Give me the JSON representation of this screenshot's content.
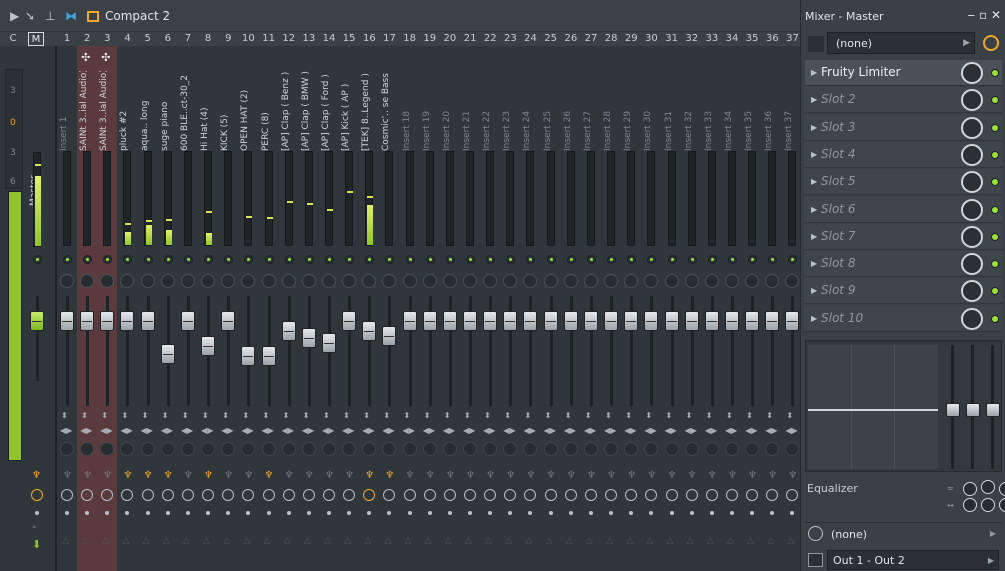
{
  "toolbar": {
    "title": "Compact 2"
  },
  "header": {
    "c_label": "C",
    "m_label": "M",
    "numbers": [
      "1",
      "2",
      "3",
      "4",
      "5",
      "6",
      "7",
      "8",
      "9",
      "10",
      "11",
      "12",
      "13",
      "14",
      "15",
      "16",
      "17",
      "18",
      "19",
      "20",
      "21",
      "22",
      "23",
      "24",
      "25",
      "26",
      "27",
      "28",
      "29",
      "30",
      "31",
      "32",
      "33",
      "34",
      "35",
      "36",
      "37"
    ]
  },
  "left": {
    "scale": [
      "3",
      "0",
      "3",
      "6"
    ],
    "master_name": "Master"
  },
  "strips": [
    {
      "name": "Insert 1",
      "dim": true,
      "red": false
    },
    {
      "name": "SAINt 3..ial Audio)",
      "dim": false,
      "red": true
    },
    {
      "name": "SAINt 3..ial Audio)",
      "dim": false,
      "red": true
    },
    {
      "name": "pluck #2",
      "dim": false,
      "red": false
    },
    {
      "name": "aqua.. long",
      "dim": false,
      "red": false
    },
    {
      "name": "suge piano",
      "dim": false,
      "red": false
    },
    {
      "name": "600 BLE..ct-30_2",
      "dim": false,
      "red": false
    },
    {
      "name": "Hi Hat (4)",
      "dim": false,
      "red": false
    },
    {
      "name": "KICK (5)",
      "dim": false,
      "red": false
    },
    {
      "name": "OPEN HAT (2)",
      "dim": false,
      "red": false
    },
    {
      "name": "PERC (8)",
      "dim": false,
      "red": false
    },
    {
      "name": "[AP] Clap ( Benz )",
      "dim": false,
      "red": false
    },
    {
      "name": "[AP] Clap ( BMW )",
      "dim": false,
      "red": false
    },
    {
      "name": "[AP] Clap ( Ford )",
      "dim": false,
      "red": false
    },
    {
      "name": "[AP] Kick ( AP )",
      "dim": false,
      "red": false
    },
    {
      "name": "[TEK] 8..Legend )",
      "dim": false,
      "red": false
    },
    {
      "name": "Cosmic'.. se Bass 1",
      "dim": false,
      "red": false
    },
    {
      "name": "Insert 18",
      "dim": true,
      "red": false
    },
    {
      "name": "Insert 19",
      "dim": true,
      "red": false
    },
    {
      "name": "Insert 20",
      "dim": true,
      "red": false
    },
    {
      "name": "Insert 21",
      "dim": true,
      "red": false
    },
    {
      "name": "Insert 22",
      "dim": true,
      "red": false
    },
    {
      "name": "Insert 23",
      "dim": true,
      "red": false
    },
    {
      "name": "Insert 24",
      "dim": true,
      "red": false
    },
    {
      "name": "Insert 25",
      "dim": true,
      "red": false
    },
    {
      "name": "Insert 26",
      "dim": true,
      "red": false
    },
    {
      "name": "Insert 27",
      "dim": true,
      "red": false
    },
    {
      "name": "Insert 28",
      "dim": true,
      "red": false
    },
    {
      "name": "Insert 29",
      "dim": true,
      "red": false
    },
    {
      "name": "Insert 30",
      "dim": true,
      "red": false
    },
    {
      "name": "Insert 31",
      "dim": true,
      "red": false
    },
    {
      "name": "Insert 32",
      "dim": true,
      "red": false
    },
    {
      "name": "Insert 33",
      "dim": true,
      "red": false
    },
    {
      "name": "Insert 34",
      "dim": true,
      "red": false
    },
    {
      "name": "Insert 35",
      "dim": true,
      "red": false
    },
    {
      "name": "Insert 36",
      "dim": true,
      "red": false
    },
    {
      "name": "Insert 37",
      "dim": true,
      "red": false
    }
  ],
  "panel": {
    "title": "Mixer - Master",
    "input": "(none)",
    "slots": [
      "Fruity Limiter",
      "Slot 2",
      "Slot 3",
      "Slot 4",
      "Slot 5",
      "Slot 6",
      "Slot 7",
      "Slot 8",
      "Slot 9",
      "Slot 10"
    ],
    "eq_label": "Equalizer",
    "sidechain": "(none)",
    "output": "Out 1 - Out 2"
  }
}
